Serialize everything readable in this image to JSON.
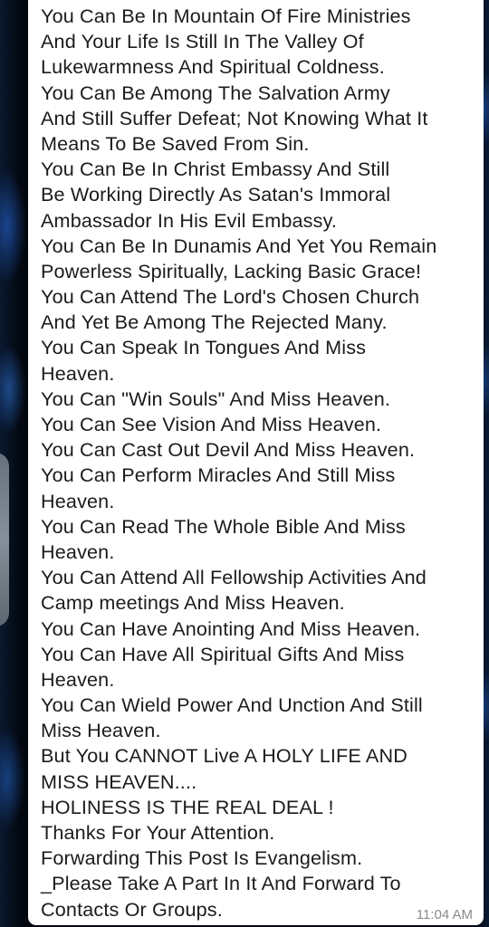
{
  "message": {
    "lines": [
      "You Can Be In Mountain Of Fire Ministries",
      "And Your Life Is Still In The Valley Of",
      "Lukewarmness And Spiritual Coldness.",
      "You Can Be Among The Salvation Army",
      "And Still Suffer Defeat; Not Knowing What It",
      "Means To Be Saved From Sin.",
      "You Can Be In Christ Embassy And Still",
      "Be Working Directly As Satan's Immoral",
      "Ambassador In His Evil Embassy.",
      "You Can Be In Dunamis And Yet You Remain",
      "Powerless Spiritually, Lacking Basic Grace!",
      "You Can Attend The Lord's Chosen Church",
      "And Yet Be Among The Rejected Many.",
      "You Can Speak In Tongues And Miss",
      "Heaven.",
      "You Can \"Win Souls\" And Miss Heaven.",
      "You Can See Vision And Miss Heaven.",
      "You Can Cast Out Devil And Miss Heaven.",
      "You Can Perform Miracles And Still Miss",
      "Heaven.",
      "You Can Read The Whole Bible And Miss",
      "Heaven.",
      "You Can Attend All Fellowship Activities And",
      "Camp meetings And Miss Heaven.",
      "You Can Have Anointing And Miss Heaven.",
      "You Can Have All Spiritual Gifts And Miss",
      "Heaven.",
      "You Can Wield Power And Unction And Still",
      "Miss Heaven.",
      "But You CANNOT Live A HOLY LIFE AND",
      "MISS HEAVEN....",
      "HOLINESS IS THE REAL DEAL !",
      "Thanks For Your Attention.",
      "Forwarding This Post Is Evangelism.",
      "_Please Take A Part In It And Forward To",
      "Contacts Or Groups."
    ],
    "timestamp": "11:04 AM"
  },
  "colors": {
    "bubble_background": "#ffffff",
    "message_text": "#1b1b1b",
    "timestamp_text": "#8a8a8a",
    "wallpaper_dark": "#030810",
    "wallpaper_glow": "#286ee6"
  }
}
